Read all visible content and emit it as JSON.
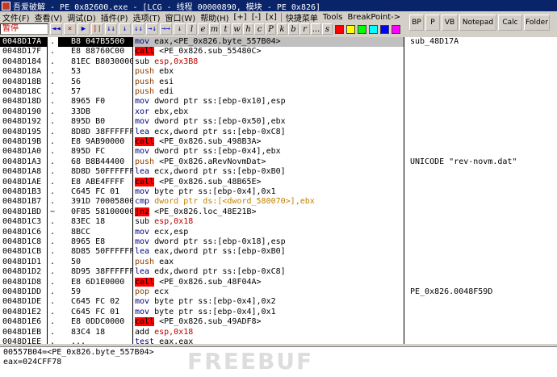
{
  "window": {
    "title": "吾爱破解 - PE_0x82600.exe - [LCG - 线程  00000890, 模块 - PE_0x826]"
  },
  "menu": {
    "items": [
      "文件(F)",
      "查看(V)",
      "调试(D)",
      "插件(P)",
      "选项(T)",
      "窗口(W)",
      "帮助(H)"
    ],
    "sys_btns": [
      "[+]",
      "[-]",
      "[x]"
    ],
    "extra": [
      "快捷菜单",
      "Tools",
      "BreakPoint->"
    ]
  },
  "toolbar": {
    "status": "暂停",
    "buttons": [
      "◄◄",
      "×",
      "▶",
      "||",
      "↓↓",
      "↓",
      "↓↓",
      "→↓",
      "→→",
      "↓"
    ],
    "letters": [
      "l",
      "e",
      "m",
      "t",
      "w",
      "h",
      "c",
      "P",
      "k",
      "b",
      "r",
      "...",
      "s"
    ],
    "colors": [
      "#ff0000",
      "#ffff00",
      "#00ff00",
      "#00ffff",
      "#0000ff",
      "#ff00ff"
    ]
  },
  "right_toolbar": {
    "buttons": [
      "BP",
      "P",
      "VB",
      "Notepad",
      "Calc",
      "Folder"
    ]
  },
  "disasm": {
    "rows": [
      {
        "addr": "0048D17A",
        "mark": ".",
        "bytes": "B8 047B5500",
        "mn": "mov",
        "ops": "eax,<PE_0x826.byte_557B04>",
        "kind": "mov",
        "comment": "sub_48D17A",
        "sel": true
      },
      {
        "addr": "0048D17F",
        "mark": ".",
        "bytes": "E8 88760C00",
        "mn": "call",
        "ops": "<PE_0x826.sub_55480C>",
        "kind": "call",
        "comment": ""
      },
      {
        "addr": "0048D184",
        "mark": ".",
        "bytes": "81EC B8030000",
        "mn": "sub",
        "ops": "esp,0x3B8",
        "kind": "other",
        "opsclass": "red",
        "comment": ""
      },
      {
        "addr": "0048D18A",
        "mark": ".",
        "bytes": "53",
        "mn": "push",
        "ops": "ebx",
        "kind": "push",
        "comment": ""
      },
      {
        "addr": "0048D18B",
        "mark": ".",
        "bytes": "56",
        "mn": "push",
        "ops": "esi",
        "kind": "push",
        "comment": ""
      },
      {
        "addr": "0048D18C",
        "mark": ".",
        "bytes": "57",
        "mn": "push",
        "ops": "edi",
        "kind": "push",
        "comment": ""
      },
      {
        "addr": "0048D18D",
        "mark": ".",
        "bytes": "8965 F0",
        "mn": "mov",
        "ops": "dword ptr ss:[ebp-0x10],esp",
        "kind": "mov",
        "comment": ""
      },
      {
        "addr": "0048D190",
        "mark": ".",
        "bytes": "33DB",
        "mn": "xor",
        "ops": "ebx,ebx",
        "kind": "mov",
        "comment": ""
      },
      {
        "addr": "0048D192",
        "mark": ".",
        "bytes": "895D B0",
        "mn": "mov",
        "ops": "dword ptr ss:[ebp-0x50],ebx",
        "kind": "mov",
        "comment": ""
      },
      {
        "addr": "0048D195",
        "mark": ".",
        "bytes": "8D8D 38FFFFFF",
        "mn": "lea",
        "ops": "ecx,dword ptr ss:[ebp-0xC8]",
        "kind": "mov",
        "comment": ""
      },
      {
        "addr": "0048D19B",
        "mark": ".",
        "bytes": "E8 9AB90000",
        "mn": "call",
        "ops": "<PE_0x826.sub_498B3A>",
        "kind": "call",
        "comment": ""
      },
      {
        "addr": "0048D1A0",
        "mark": ".",
        "bytes": "895D FC",
        "mn": "mov",
        "ops": "dword ptr ss:[ebp-0x4],ebx",
        "kind": "mov",
        "comment": ""
      },
      {
        "addr": "0048D1A3",
        "mark": ".",
        "bytes": "68 B8B44400",
        "mn": "push",
        "ops": "<PE_0x826.aRevNovmDat>",
        "kind": "push",
        "comment": "UNICODE \"rev-novm.dat\""
      },
      {
        "addr": "0048D1A8",
        "mark": ".",
        "bytes": "8D8D 50FFFFFF",
        "mn": "lea",
        "ops": "ecx,dword ptr ss:[ebp-0xB0]",
        "kind": "mov",
        "comment": ""
      },
      {
        "addr": "0048D1AE",
        "mark": ".",
        "bytes": "E8 ABE4FFFF",
        "mn": "call",
        "ops": "<PE_0x826.sub_48B65E>",
        "kind": "call",
        "comment": ""
      },
      {
        "addr": "0048D1B3",
        "mark": ".",
        "bytes": "C645 FC 01",
        "mn": "mov",
        "ops": "byte ptr ss:[ebp-0x4],0x1",
        "kind": "mov",
        "comment": ""
      },
      {
        "addr": "0048D1B7",
        "mark": ".",
        "bytes": "391D 70005800",
        "mn": "cmp",
        "ops": "dword ptr ds:[<dword_580070>],ebx",
        "kind": "cmp",
        "opsclass": "gold",
        "comment": ""
      },
      {
        "addr": "0048D1BD",
        "mark": "~",
        "bytes": "0F85 58100000",
        "mn": "jnz",
        "ops": "<PE_0x826.loc_48E21B>",
        "kind": "jcc",
        "comment": ""
      },
      {
        "addr": "0048D1C3",
        "mark": ".",
        "bytes": "83EC 18",
        "mn": "sub",
        "ops": "esp,0x18",
        "kind": "other",
        "opsclass": "red",
        "comment": ""
      },
      {
        "addr": "0048D1C6",
        "mark": ".",
        "bytes": "8BCC",
        "mn": "mov",
        "ops": "ecx,esp",
        "kind": "mov",
        "comment": ""
      },
      {
        "addr": "0048D1C8",
        "mark": ".",
        "bytes": "8965 E8",
        "mn": "mov",
        "ops": "dword ptr ss:[ebp-0x18],esp",
        "kind": "mov",
        "comment": ""
      },
      {
        "addr": "0048D1CB",
        "mark": ".",
        "bytes": "8D85 50FFFFFF",
        "mn": "lea",
        "ops": "eax,dword ptr ss:[ebp-0xB0]",
        "kind": "mov",
        "comment": ""
      },
      {
        "addr": "0048D1D1",
        "mark": ".",
        "bytes": "50",
        "mn": "push",
        "ops": "eax",
        "kind": "push",
        "comment": ""
      },
      {
        "addr": "0048D1D2",
        "mark": ".",
        "bytes": "8D95 38FFFFFF",
        "mn": "lea",
        "ops": "edx,dword ptr ss:[ebp-0xC8]",
        "kind": "mov",
        "comment": ""
      },
      {
        "addr": "0048D1D8",
        "mark": ".",
        "bytes": "E8 6D1E0000",
        "mn": "call",
        "ops": "<PE_0x826.sub_48F04A>",
        "kind": "call",
        "comment": ""
      },
      {
        "addr": "0048D1DD",
        "mark": ".",
        "bytes": "59",
        "mn": "pop",
        "ops": "ecx",
        "kind": "push",
        "comment": "PE_0x826.0048F59D"
      },
      {
        "addr": "0048D1DE",
        "mark": ".",
        "bytes": "C645 FC 02",
        "mn": "mov",
        "ops": "byte ptr ss:[ebp-0x4],0x2",
        "kind": "mov",
        "comment": ""
      },
      {
        "addr": "0048D1E2",
        "mark": ".",
        "bytes": "C645 FC 01",
        "mn": "mov",
        "ops": "byte ptr ss:[ebp-0x4],0x1",
        "kind": "mov",
        "comment": ""
      },
      {
        "addr": "0048D1E6",
        "mark": ".",
        "bytes": "E8 0DDC0000",
        "mn": "call",
        "ops": "<PE_0x826.sub_49ADF8>",
        "kind": "call",
        "comment": ""
      },
      {
        "addr": "0048D1EB",
        "mark": ".",
        "bytes": "83C4 18",
        "mn": "add",
        "ops": "esp,0x18",
        "kind": "other",
        "opsclass": "red",
        "comment": ""
      },
      {
        "addr": "0048D1EE",
        "mark": ".",
        "bytes": "...",
        "mn": "test",
        "ops": "eax,eax",
        "kind": "mov",
        "comment": ""
      }
    ]
  },
  "info": {
    "line1": "00557B04=<PE_0x826.byte_557B04>",
    "line2": "eax=024CFF78"
  },
  "watermark": "FREEBUF"
}
